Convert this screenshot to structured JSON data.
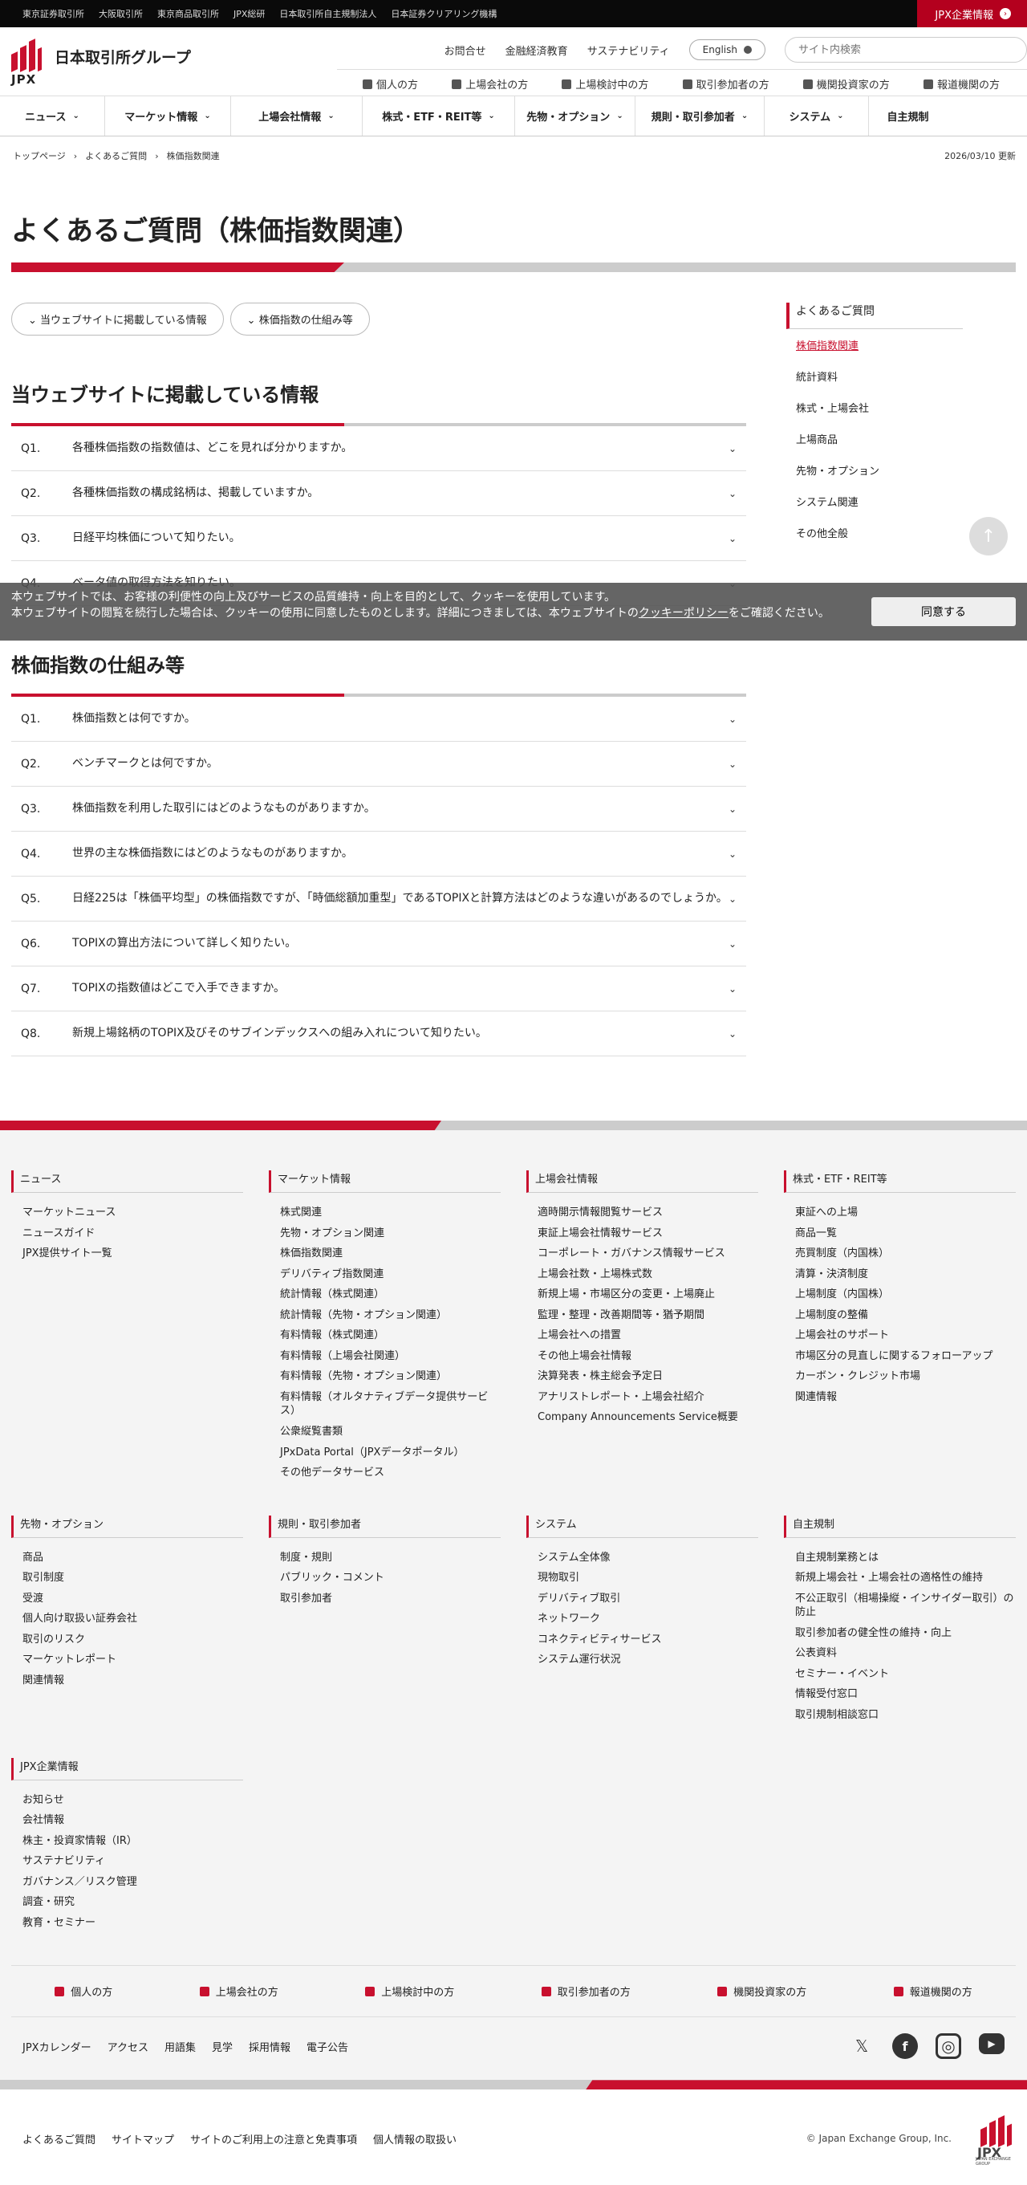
{
  "topbar": {
    "links": [
      "東京証券取引所",
      "大阪取引所",
      "東京商品取引所",
      "JPX総研",
      "日本取引所自主規制法人",
      "日本証券クリアリング機構"
    ],
    "corp_link": "JPX企業情報"
  },
  "header": {
    "logo_text": "JPX",
    "group_name": "日本取引所グループ",
    "util_links": [
      "お問合せ",
      "金融経済教育",
      "サステナビリティ"
    ],
    "lang_label": "English",
    "search_placeholder": "サイト内検索",
    "audience_links": [
      "個人の方",
      "上場会社の方",
      "上場検討中の方",
      "取引参加者の方",
      "機関投資家の方",
      "報道機関の方"
    ]
  },
  "gnav": [
    "ニュース",
    "マーケット情報",
    "上場会社情報",
    "株式・ETF・REIT等",
    "先物・オプション",
    "規則・取引参加者",
    "システム",
    "自主規制"
  ],
  "breadcrumb": {
    "items": [
      "トップページ",
      "よくあるご質問",
      "株価指数関連"
    ],
    "updated": "2026/03/10 更新"
  },
  "page_title": "よくあるご質問（株価指数関連）",
  "pills": [
    "当ウェブサイトに掲載している情報",
    "株価指数の仕組み等"
  ],
  "sections": [
    {
      "title": "当ウェブサイトに掲載している情報",
      "items": [
        {
          "num": "Q1.",
          "text": "各種株価指数の指数値は、どこを見れば分かりますか。"
        },
        {
          "num": "Q2.",
          "text": "各種株価指数の構成銘柄は、掲載していますか。"
        },
        {
          "num": "Q3.",
          "text": "日経平均株価について知りたい。"
        },
        {
          "num": "Q4.",
          "text": "ベータ値の取得方法を知りたい。"
        }
      ]
    },
    {
      "title": "株価指数の仕組み等",
      "items": [
        {
          "num": "Q1.",
          "text": "株価指数とは何ですか。"
        },
        {
          "num": "Q2.",
          "text": "ベンチマークとは何ですか。"
        },
        {
          "num": "Q3.",
          "text": "株価指数を利用した取引にはどのようなものがありますか。"
        },
        {
          "num": "Q4.",
          "text": "世界の主な株価指数にはどのようなものがありますか。"
        },
        {
          "num": "Q5.",
          "text": "日経225は「株価平均型」の株価指数ですが、「時価総額加重型」であるTOPIXと計算方法はどのような違いがあるのでしょうか。"
        },
        {
          "num": "Q6.",
          "text": "TOPIXの算出方法について詳しく知りたい。"
        },
        {
          "num": "Q7.",
          "text": "TOPIXの指数値はどこで入手できますか。"
        },
        {
          "num": "Q8.",
          "text": "新規上場銘柄のTOPIX及びそのサブインデックスへの組み入れについて知りたい。"
        }
      ]
    }
  ],
  "sidebar": {
    "title": "よくあるご質問",
    "items": [
      "株価指数関連",
      "統計資料",
      "株式・上場会社",
      "上場商品",
      "先物・オプション",
      "システム関連",
      "その他全般"
    ],
    "active_index": 0
  },
  "cookie": {
    "text1": "本ウェブサイトでは、お客様の利便性の向上及びサービスの品質維持・向上を目的として、クッキーを使用しています。",
    "text2": "本ウェブサイトの閲覧を続行した場合は、クッキーの使用に同意したものとします。詳細につきましては、本ウェブサイトの",
    "link": "クッキーポリシー",
    "text3": "をご確認ください。",
    "button": "同意する"
  },
  "footer": {
    "columns": [
      {
        "title": "ニュース",
        "links": [
          "マーケットニュース",
          "ニュースガイド",
          "JPX提供サイト一覧"
        ]
      },
      {
        "title": "マーケット情報",
        "links": [
          "株式関連",
          "先物・オプション関連",
          "株価指数関連",
          "デリバティブ指数関連",
          "統計情報（株式関連）",
          "統計情報（先物・オプション関連）",
          "有料情報（株式関連）",
          "有料情報（上場会社関連）",
          "有料情報（先物・オプション関連）",
          "有料情報（オルタナティブデータ提供サービス）",
          "公衆縦覧書類",
          "JPxData Portal（JPXデータポータル）",
          "その他データサービス"
        ]
      },
      {
        "title": "上場会社情報",
        "links": [
          "適時開示情報閲覧サービス",
          "東証上場会社情報サービス",
          "コーポレート・ガバナンス情報サービス",
          "上場会社数・上場株式数",
          "新規上場・市場区分の変更・上場廃止",
          "監理・整理・改善期間等・猶予期間",
          "上場会社への措置",
          "その他上場会社情報",
          "決算発表・株主総会予定日",
          "アナリストレポート・上場会社紹介",
          "Company Announcements Service概要"
        ]
      },
      {
        "title": "株式・ETF・REIT等",
        "links": [
          "東証への上場",
          "商品一覧",
          "売買制度（内国株）",
          "清算・決済制度",
          "上場制度（内国株）",
          "上場制度の整備",
          "上場会社のサポート",
          "市場区分の見直しに関するフォローアップ",
          "カーボン・クレジット市場",
          "関連情報"
        ]
      },
      {
        "title": "先物・オプション",
        "links": [
          "商品",
          "取引制度",
          "受渡",
          "個人向け取扱い証券会社",
          "取引のリスク",
          "マーケットレポート",
          "関連情報"
        ]
      },
      {
        "title": "規則・取引参加者",
        "links": [
          "制度・規則",
          "パブリック・コメント",
          "取引参加者"
        ]
      },
      {
        "title": "システム",
        "links": [
          "システム全体像",
          "現物取引",
          "デリバティブ取引",
          "ネットワーク",
          "コネクティビティサービス",
          "システム運行状況"
        ]
      },
      {
        "title": "自主規制",
        "links": [
          "自主規制業務とは",
          "新規上場会社・上場会社の適格性の維持",
          "不公正取引（相場操縦・インサイダー取引）の防止",
          "取引参加者の健全性の維持・向上",
          "公表資料",
          "セミナー・イベント",
          "情報受付窓口",
          "取引規制相談窓口"
        ]
      },
      {
        "title": "JPX企業情報",
        "links": [
          "お知らせ",
          "会社情報",
          "株主・投資家情報（IR）",
          "サステナビリティ",
          "ガバナンス／リスク管理",
          "調査・研究",
          "教育・セミナー"
        ]
      }
    ],
    "personas": [
      "個人の方",
      "上場会社の方",
      "上場検討中の方",
      "取引参加者の方",
      "機関投資家の方",
      "報道機関の方"
    ],
    "sub_links": [
      "JPXカレンダー",
      "アクセス",
      "用語集",
      "見学",
      "採用情報",
      "電子公告"
    ],
    "bottom_links": [
      "よくあるご質問",
      "サイトマップ",
      "サイトのご利用上の注意と免責事項",
      "個人情報の取扱い"
    ],
    "copyright": "© Japan Exchange Group, Inc.",
    "logo_sub": "JAPAN EXCHANGE GROUP"
  },
  "colors": {
    "accent": "#c8102e",
    "topbar": "#0a0a0a"
  }
}
